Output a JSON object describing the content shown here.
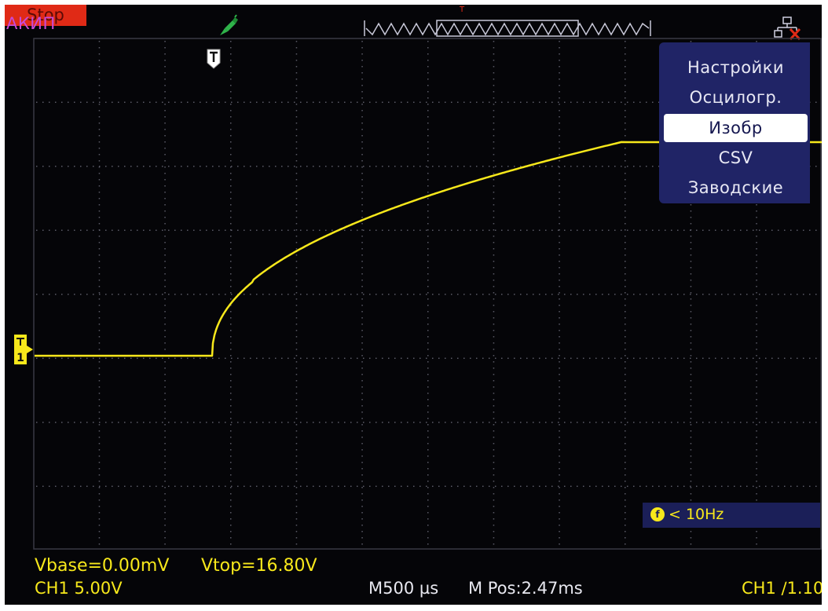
{
  "topbar": {
    "brand": "АКИП",
    "run_state": "Stop",
    "icons": [
      "probe-icon",
      "memory-depth-icon",
      "network-disconnected-icon"
    ]
  },
  "trigger": {
    "marker_label": "T"
  },
  "channel": {
    "marker_label": "1"
  },
  "menu": {
    "items": [
      "Настройки",
      "Осцилогр.",
      "Изобр",
      "CSV",
      "Заводские"
    ],
    "selected": "Изобр"
  },
  "frequency": {
    "icon": "f",
    "text": "< 10Hz"
  },
  "measurements": {
    "vbase": "Vbase=0.00mV",
    "vtop": "Vtop=16.80V"
  },
  "status": {
    "ch1": "CH1 5.00V",
    "timebase": "M500 µs",
    "mpos": "M Pos:2.47ms",
    "trigger_source": "CH1 ∕1.10"
  },
  "colors": {
    "trace": "#f7e81b",
    "menu_bg": "#202466",
    "stop_bg": "#e02a16",
    "brand": "#c84ad8",
    "screen_bg": "#050508"
  }
}
